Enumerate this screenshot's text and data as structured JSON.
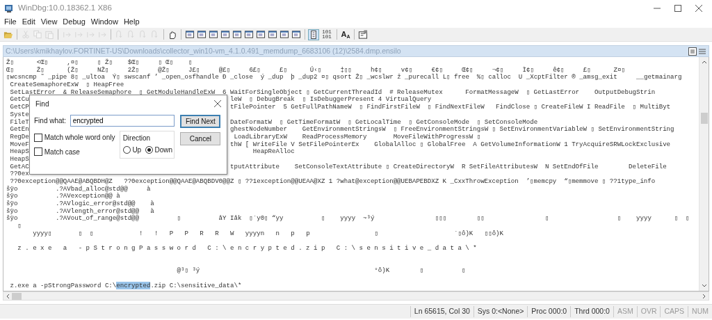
{
  "window": {
    "title": "WinDbg:10.0.18362.1 X86"
  },
  "menu": [
    "File",
    "Edit",
    "View",
    "Debug",
    "Window",
    "Help"
  ],
  "toolbar": [
    {
      "kind": "open",
      "disabled": false,
      "selected": false
    },
    {
      "kind": "separator"
    },
    {
      "kind": "cut",
      "disabled": true,
      "selected": false
    },
    {
      "kind": "copy",
      "disabled": true,
      "selected": false
    },
    {
      "kind": "paste",
      "disabled": true,
      "selected": false
    },
    {
      "kind": "separator"
    },
    {
      "kind": "run",
      "disabled": true,
      "selected": false
    },
    {
      "kind": "run",
      "disabled": true,
      "selected": false
    },
    {
      "kind": "run",
      "disabled": true,
      "selected": false
    },
    {
      "kind": "run",
      "disabled": true,
      "selected": false
    },
    {
      "kind": "separator"
    },
    {
      "kind": "step",
      "disabled": true,
      "selected": false
    },
    {
      "kind": "step",
      "disabled": true,
      "selected": false
    },
    {
      "kind": "step",
      "disabled": true,
      "selected": false
    },
    {
      "kind": "step",
      "disabled": true,
      "selected": false
    },
    {
      "kind": "separator"
    },
    {
      "kind": "hand",
      "disabled": false,
      "selected": false
    },
    {
      "kind": "separator"
    },
    {
      "kind": "window",
      "disabled": false,
      "selected": false
    },
    {
      "kind": "window",
      "disabled": false,
      "selected": false
    },
    {
      "kind": "window",
      "disabled": false,
      "selected": false
    },
    {
      "kind": "window",
      "disabled": false,
      "selected": false
    },
    {
      "kind": "window",
      "disabled": false,
      "selected": false
    },
    {
      "kind": "window",
      "disabled": false,
      "selected": false
    },
    {
      "kind": "window",
      "disabled": false,
      "selected": false
    },
    {
      "kind": "window",
      "disabled": false,
      "selected": false
    },
    {
      "kind": "window",
      "disabled": false,
      "selected": false
    },
    {
      "kind": "window",
      "disabled": false,
      "selected": false
    },
    {
      "kind": "separator"
    },
    {
      "kind": "source",
      "disabled": false,
      "selected": true
    },
    {
      "kind": "binary",
      "disabled": false,
      "selected": false,
      "label": [
        "101",
        "101"
      ]
    },
    {
      "kind": "separator"
    },
    {
      "kind": "font",
      "disabled": false,
      "selected": false,
      "label": "A$_{A}$"
    },
    {
      "kind": "separator"
    },
    {
      "kind": "options",
      "disabled": false,
      "selected": false
    }
  ],
  "document": {
    "path": "C:\\Users\\kmikhaylov.FORTINET-US\\Downloads\\collector_win10-vm_4.1.0.491_memdump_6683106 (12)\\2584.dmp.ensilo",
    "lines": [
      {
        "kind": "plain",
        "text": "Ž▯      <Œ▯     ,¤▯     ▯ Ž▯    $Œ▯     ▯ Œ▯    ▯"
      },
      {
        "kind": "plain",
        "text": "Œ▯      Ž▯      (Ž▯     NŽ▯     2Ž▯     @Ž▯     J£▯     @£▯     6£▯     £▯      Ú‹▯     ‡▯▯     h¢▯     v¢▯     €¢▯     Œ¢▯     ¬¢▯     Ì¢▯     ê¢▯     £▯      Z¤▯"
      },
      {
        "kind": "plain",
        "text": "▯wcsncmp ˜ _pipe 8▯ _ultoa  Ý▯ swscanf ’ _open_osfhandle Ð _close  ý _dup  þ _dup2 ¤▯ qsort Ž▯ _wcslwr ž _purecall L▯ free  %▯ calloc  U _XcptFilter ® _amsg_exit     __getmainarg"
      },
      {
        "kind": "plain",
        "text": " CreateSemaphoreExW  ▯ HeapFree"
      },
      {
        "kind": "plain",
        "text": " SetLastError  & ReleaseSemaphore  ▯ GetModuleHandleExW  6 WaitForSingleObject ▯ GetCurrentThreadId  # ReleaseMutex      FormatMessageW  ▯ GetLastError    OutputDebugStrin"
      },
      {
        "kind": "covered",
        "left": " GetCu",
        "right": "leW  ▯ DebugBreak  ▯ IsDebuggerPresent 4 VirtualQuery"
      },
      {
        "kind": "covered",
        "left": " GetCP",
        "right": "tFilePointer  5 GetFullPathNameW  ▯ FindFirstFileW  ▯ FindNextFileW   FindClose ▯ CreateFileW I ReadFile  ▯ MultiByt"
      },
      {
        "kind": "covered",
        "left": " Syste"
      },
      {
        "kind": "covered",
        "left": " FileT",
        "right": "DateFormatW  ▯ GetTimeFormatW  ▯ GetLocalTime  ▯ GetConsoleMode  ▯ SetConsoleMode"
      },
      {
        "kind": "covered",
        "left": " GetEn",
        "right": "ghestNodeNumber    GetEnvironmentStringsW  ▯ FreeEnvironmentStringsW ▯ SetEnvironmentVariableW ▯ SetEnvironmentString"
      },
      {
        "kind": "covered",
        "left": " RegDe",
        "right": " LoadLibraryExW    ReadProcessMemory       MoveFileWithProgressW ▯"
      },
      {
        "kind": "covered",
        "left": " MoveF",
        "right": "thW [ WriteFile V SetFilePointerEx    GlobalAlloc ▯ GlobalFree  A GetVolumeInformationW 1 TryAcquireSRWLockExclusive"
      },
      {
        "kind": "covered",
        "left": " HeapS",
        "right": "      HeapReAlloc"
      },
      {
        "kind": "covered",
        "left": " HeapS"
      },
      {
        "kind": "covered",
        "left": " GetAC",
        "right": "tputAttribute    SetConsoleTextAttribute ▯ CreateDirectoryW  R SetFileAttributesW  N SetEndOfFile        DeleteFile"
      },
      {
        "kind": "covered",
        "left": " ??0ex"
      },
      {
        "kind": "plain",
        "text": " ??0exception@@QAAE@ABQBDH@Z   ??0exception@@QAAE@ABQBDV0@@Z ▯ ??1exception@@UEAA@XZ 1 ?what@exception@@UEBAPEBDXZ K _CxxThrowException  ’▯memcpy  “▯memmove ▯ ??1type_info"
      },
      {
        "kind": "plain",
        "text": "šÿo          .?AVbad_alloc@std@@     à"
      },
      {
        "kind": "plain",
        "text": "šÿo          .?AVexception@@ à"
      },
      {
        "kind": "plain",
        "text": "šÿo          .?AVlogic_error@std@@    à"
      },
      {
        "kind": "plain",
        "text": "šÿo          .?AVlength_error@std@@   à"
      },
      {
        "kind": "plain",
        "text": "šÿo          .?AVout_of_range@std@@          ▯          åY Iåk  ▯`y0▯ “yy          ▯    yyyy  ~³ý                ▯▯▯        ▯▯                ▯                  ▯    yyyy      ▯  ▯"
      },
      {
        "kind": "plain",
        "text": "   ▯"
      },
      {
        "kind": "plain",
        "text": "       yyyy▯       ▯  ▯            !   !   P   P   R   R   W   yyyyn   n   p   p                 ▯                    `▯ô)K   ▯▯ô)K"
      },
      {
        "kind": "para",
        "text": "   z . e x e   a   - p S t r o n g P a s s w o r d   C : \\ e n c r y p t e d . z i p   C : \\ s e n s i t i v e _ d a t a \\ *"
      },
      {
        "kind": "section",
        "text": "                                             @³▯ ³ý                                              °ô)K        ▯          ▯"
      }
    ],
    "match_line": {
      "before": " z.exe a -pStrongPassword C:\\",
      "match": "encrypted",
      "after": ".zip C:\\sensitive_data\\*"
    }
  },
  "find_dialog": {
    "title": "Find",
    "find_label": "Find what:",
    "value": "encrypted",
    "find_next": "Find Next",
    "cancel": "Cancel",
    "options": [
      {
        "label": "Match whole word only",
        "checked": false
      },
      {
        "label": "Match case",
        "checked": false
      }
    ],
    "direction": {
      "label": "Direction",
      "options": [
        {
          "label": "Up",
          "selected": false
        },
        {
          "label": "Down",
          "selected": true
        }
      ]
    }
  },
  "status_bar": [
    {
      "text": "Ln 65615, Col 30"
    },
    {
      "text": "Sys 0:<None>"
    },
    {
      "text": "Proc 000:0"
    },
    {
      "text": "Thrd 000:0"
    },
    {
      "text": "ASM",
      "on": false
    },
    {
      "text": "OVR",
      "on": false
    },
    {
      "text": "CAPS",
      "on": false
    },
    {
      "text": "NUM",
      "on": false
    }
  ]
}
